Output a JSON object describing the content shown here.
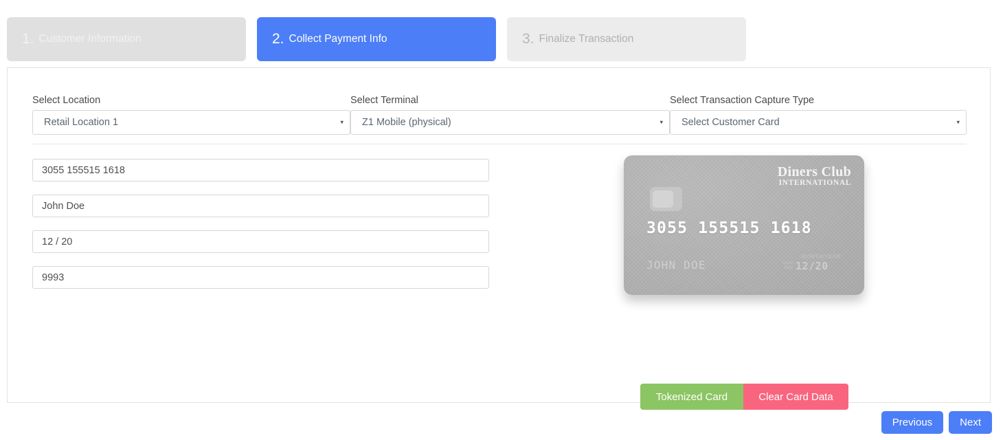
{
  "wizard": {
    "steps": [
      {
        "number": "1.",
        "label": "Customer Information",
        "state": "done"
      },
      {
        "number": "2.",
        "label": "Collect Payment Info",
        "state": "active"
      },
      {
        "number": "3.",
        "label": "Finalize Transaction",
        "state": "pending"
      }
    ]
  },
  "selects": {
    "location": {
      "label": "Select Location",
      "value": "Retail Location 1",
      "caret": "▾"
    },
    "terminal": {
      "label": "Select Terminal",
      "value": "Z1 Mobile (physical)",
      "caret": "▾"
    },
    "capture_type": {
      "label": "Select Transaction Capture Type",
      "value": "Select Customer Card",
      "caret": "▾"
    }
  },
  "card_form": {
    "number": "3055 155515 1618",
    "name": "John Doe",
    "expiry": "12 / 20",
    "cvv": "9993"
  },
  "credit_card": {
    "brand_main": "Diners Club",
    "brand_sub": "INTERNATIONAL",
    "number": "3055  155515  1618",
    "name": "JOHN  DOE",
    "expiry_caption": "MONTH/YEAR",
    "valid_line1": "valid",
    "valid_line2": "thru",
    "expiry_value": "12/20"
  },
  "actions": {
    "tokenize_label": "Tokenized Card",
    "clear_label": "Clear Card Data"
  },
  "footer": {
    "previous_label": "Previous",
    "next_label": "Next"
  },
  "colors": {
    "accent_blue": "#4c7ef8",
    "step_done_gray": "#e0e0e0",
    "step_pending_gray": "#ececec",
    "green": "#8cc564",
    "pink": "#f9657f",
    "card_gray": "#b2b2b2"
  }
}
